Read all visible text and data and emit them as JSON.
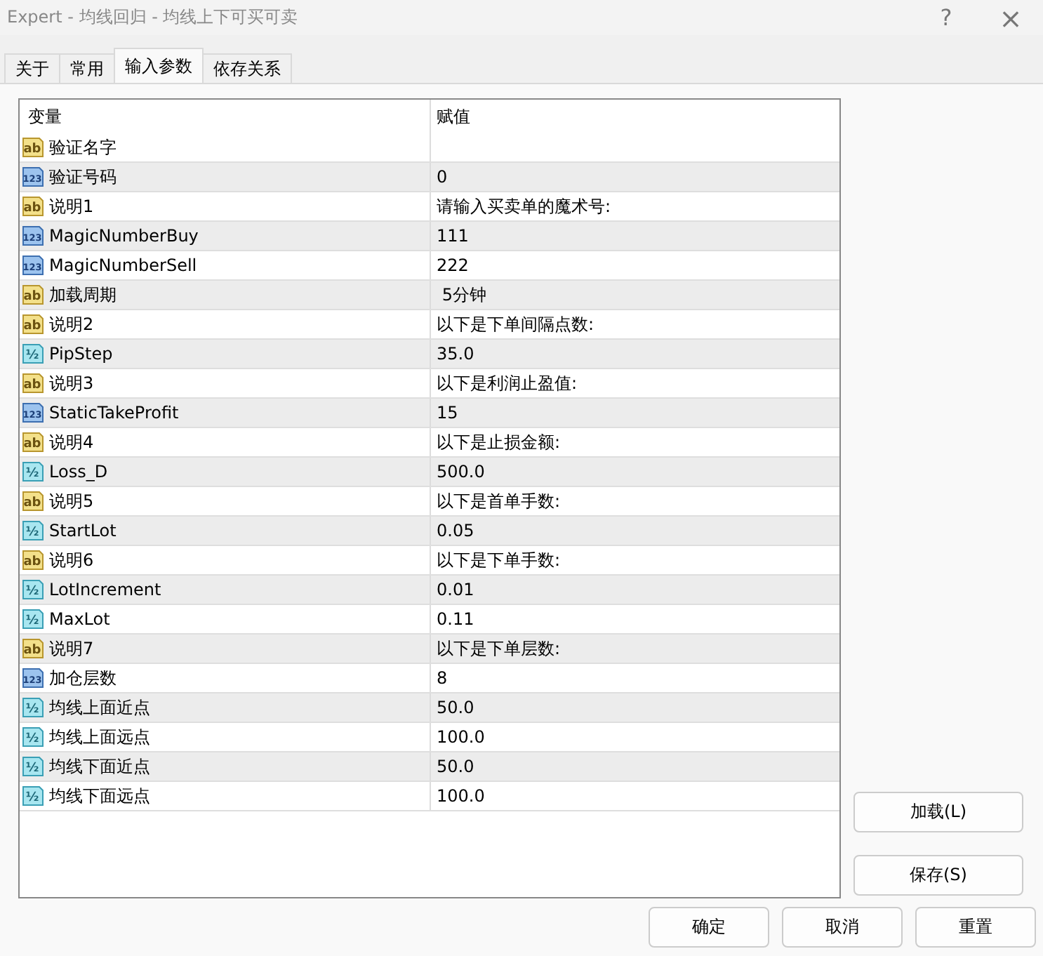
{
  "window": {
    "title": "Expert - 均线回归 - 均线上下可买可卖",
    "help": "?",
    "close": "×"
  },
  "tabs": [
    {
      "label": "关于",
      "selected": false
    },
    {
      "label": "常用",
      "selected": false
    },
    {
      "label": "输入参数",
      "selected": true
    },
    {
      "label": "依存关系",
      "selected": false
    }
  ],
  "table": {
    "columns": [
      "变量",
      "赋值"
    ],
    "rows": [
      {
        "kind": "string",
        "icon": "ab",
        "name": "验证名字"
      },
      {
        "kind": "int",
        "icon": "123",
        "name": "验证号码",
        "value": "0"
      },
      {
        "kind": "string",
        "icon": "ab",
        "name": "说明1",
        "value": "请输入买卖单的魔术号:"
      },
      {
        "kind": "int",
        "icon": "123",
        "name": "MagicNumberBuy",
        "value": "111"
      },
      {
        "kind": "int",
        "icon": "123",
        "name": "MagicNumberSell",
        "value": "222"
      },
      {
        "kind": "string",
        "icon": "ab",
        "name": "加载周期",
        "value": " 5分钟"
      },
      {
        "kind": "string",
        "icon": "ab",
        "name": "说明2",
        "value": "以下是下单间隔点数:"
      },
      {
        "kind": "double",
        "icon": "½",
        "name": "PipStep",
        "value": "35.0"
      },
      {
        "kind": "string",
        "icon": "ab",
        "name": "说明3",
        "value": "以下是利润止盈值:"
      },
      {
        "kind": "int",
        "icon": "123",
        "name": "StaticTakeProfit",
        "value": "15"
      },
      {
        "kind": "string",
        "icon": "ab",
        "name": "说明4",
        "value": "以下是止损金额:"
      },
      {
        "kind": "double",
        "icon": "½",
        "name": "Loss_D",
        "value": "500.0"
      },
      {
        "kind": "string",
        "icon": "ab",
        "name": "说明5",
        "value": "以下是首单手数:"
      },
      {
        "kind": "double",
        "icon": "½",
        "name": "StartLot",
        "value": "0.05"
      },
      {
        "kind": "string",
        "icon": "ab",
        "name": "说明6",
        "value": "以下是下单手数:"
      },
      {
        "kind": "double",
        "icon": "½",
        "name": "LotIncrement",
        "value": "0.01"
      },
      {
        "kind": "double",
        "icon": "½",
        "name": "MaxLot",
        "value": "0.11"
      },
      {
        "kind": "string",
        "icon": "ab",
        "name": "说明7",
        "value": "以下是下单层数:"
      },
      {
        "kind": "int",
        "icon": "123",
        "name": "加仓层数",
        "value": "8"
      },
      {
        "kind": "double",
        "icon": "½",
        "name": "均线上面近点",
        "value": "50.0"
      },
      {
        "kind": "double",
        "icon": "½",
        "name": "均线上面远点",
        "value": "100.0"
      },
      {
        "kind": "double",
        "icon": "½",
        "name": "均线下面近点",
        "value": "50.0"
      },
      {
        "kind": "double",
        "icon": "½",
        "name": "均线下面远点",
        "value": "100.0"
      }
    ]
  },
  "side_buttons": [
    "加载(L)",
    "保存(S)"
  ],
  "buttons": [
    "确定",
    "取消",
    "重置"
  ]
}
